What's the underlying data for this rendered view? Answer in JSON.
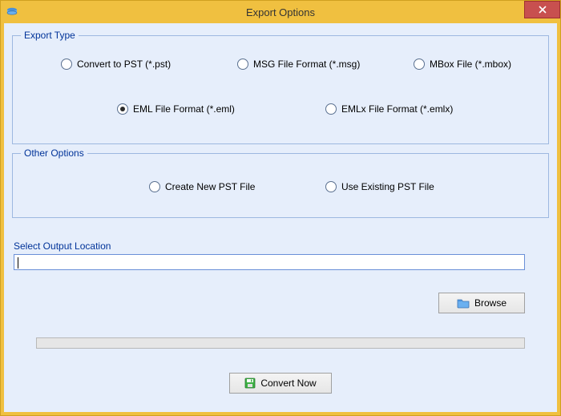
{
  "window": {
    "title": "Export Options"
  },
  "groups": {
    "export_type": "Export Type",
    "other_options": "Other Options"
  },
  "radios": {
    "pst": "Convert to PST (*.pst)",
    "msg": "MSG File Format (*.msg)",
    "mbox": "MBox File (*.mbox)",
    "eml": "EML File Format (*.eml)",
    "emlx": "EMLx File Format (*.emlx)",
    "create_new": "Create  New  PST  File",
    "use_existing": "Use Existing PST File"
  },
  "selected_export": "eml",
  "selected_other": "",
  "output": {
    "label": "Select Output Location",
    "value": ""
  },
  "buttons": {
    "browse": "Browse",
    "convert": "Convert Now"
  }
}
